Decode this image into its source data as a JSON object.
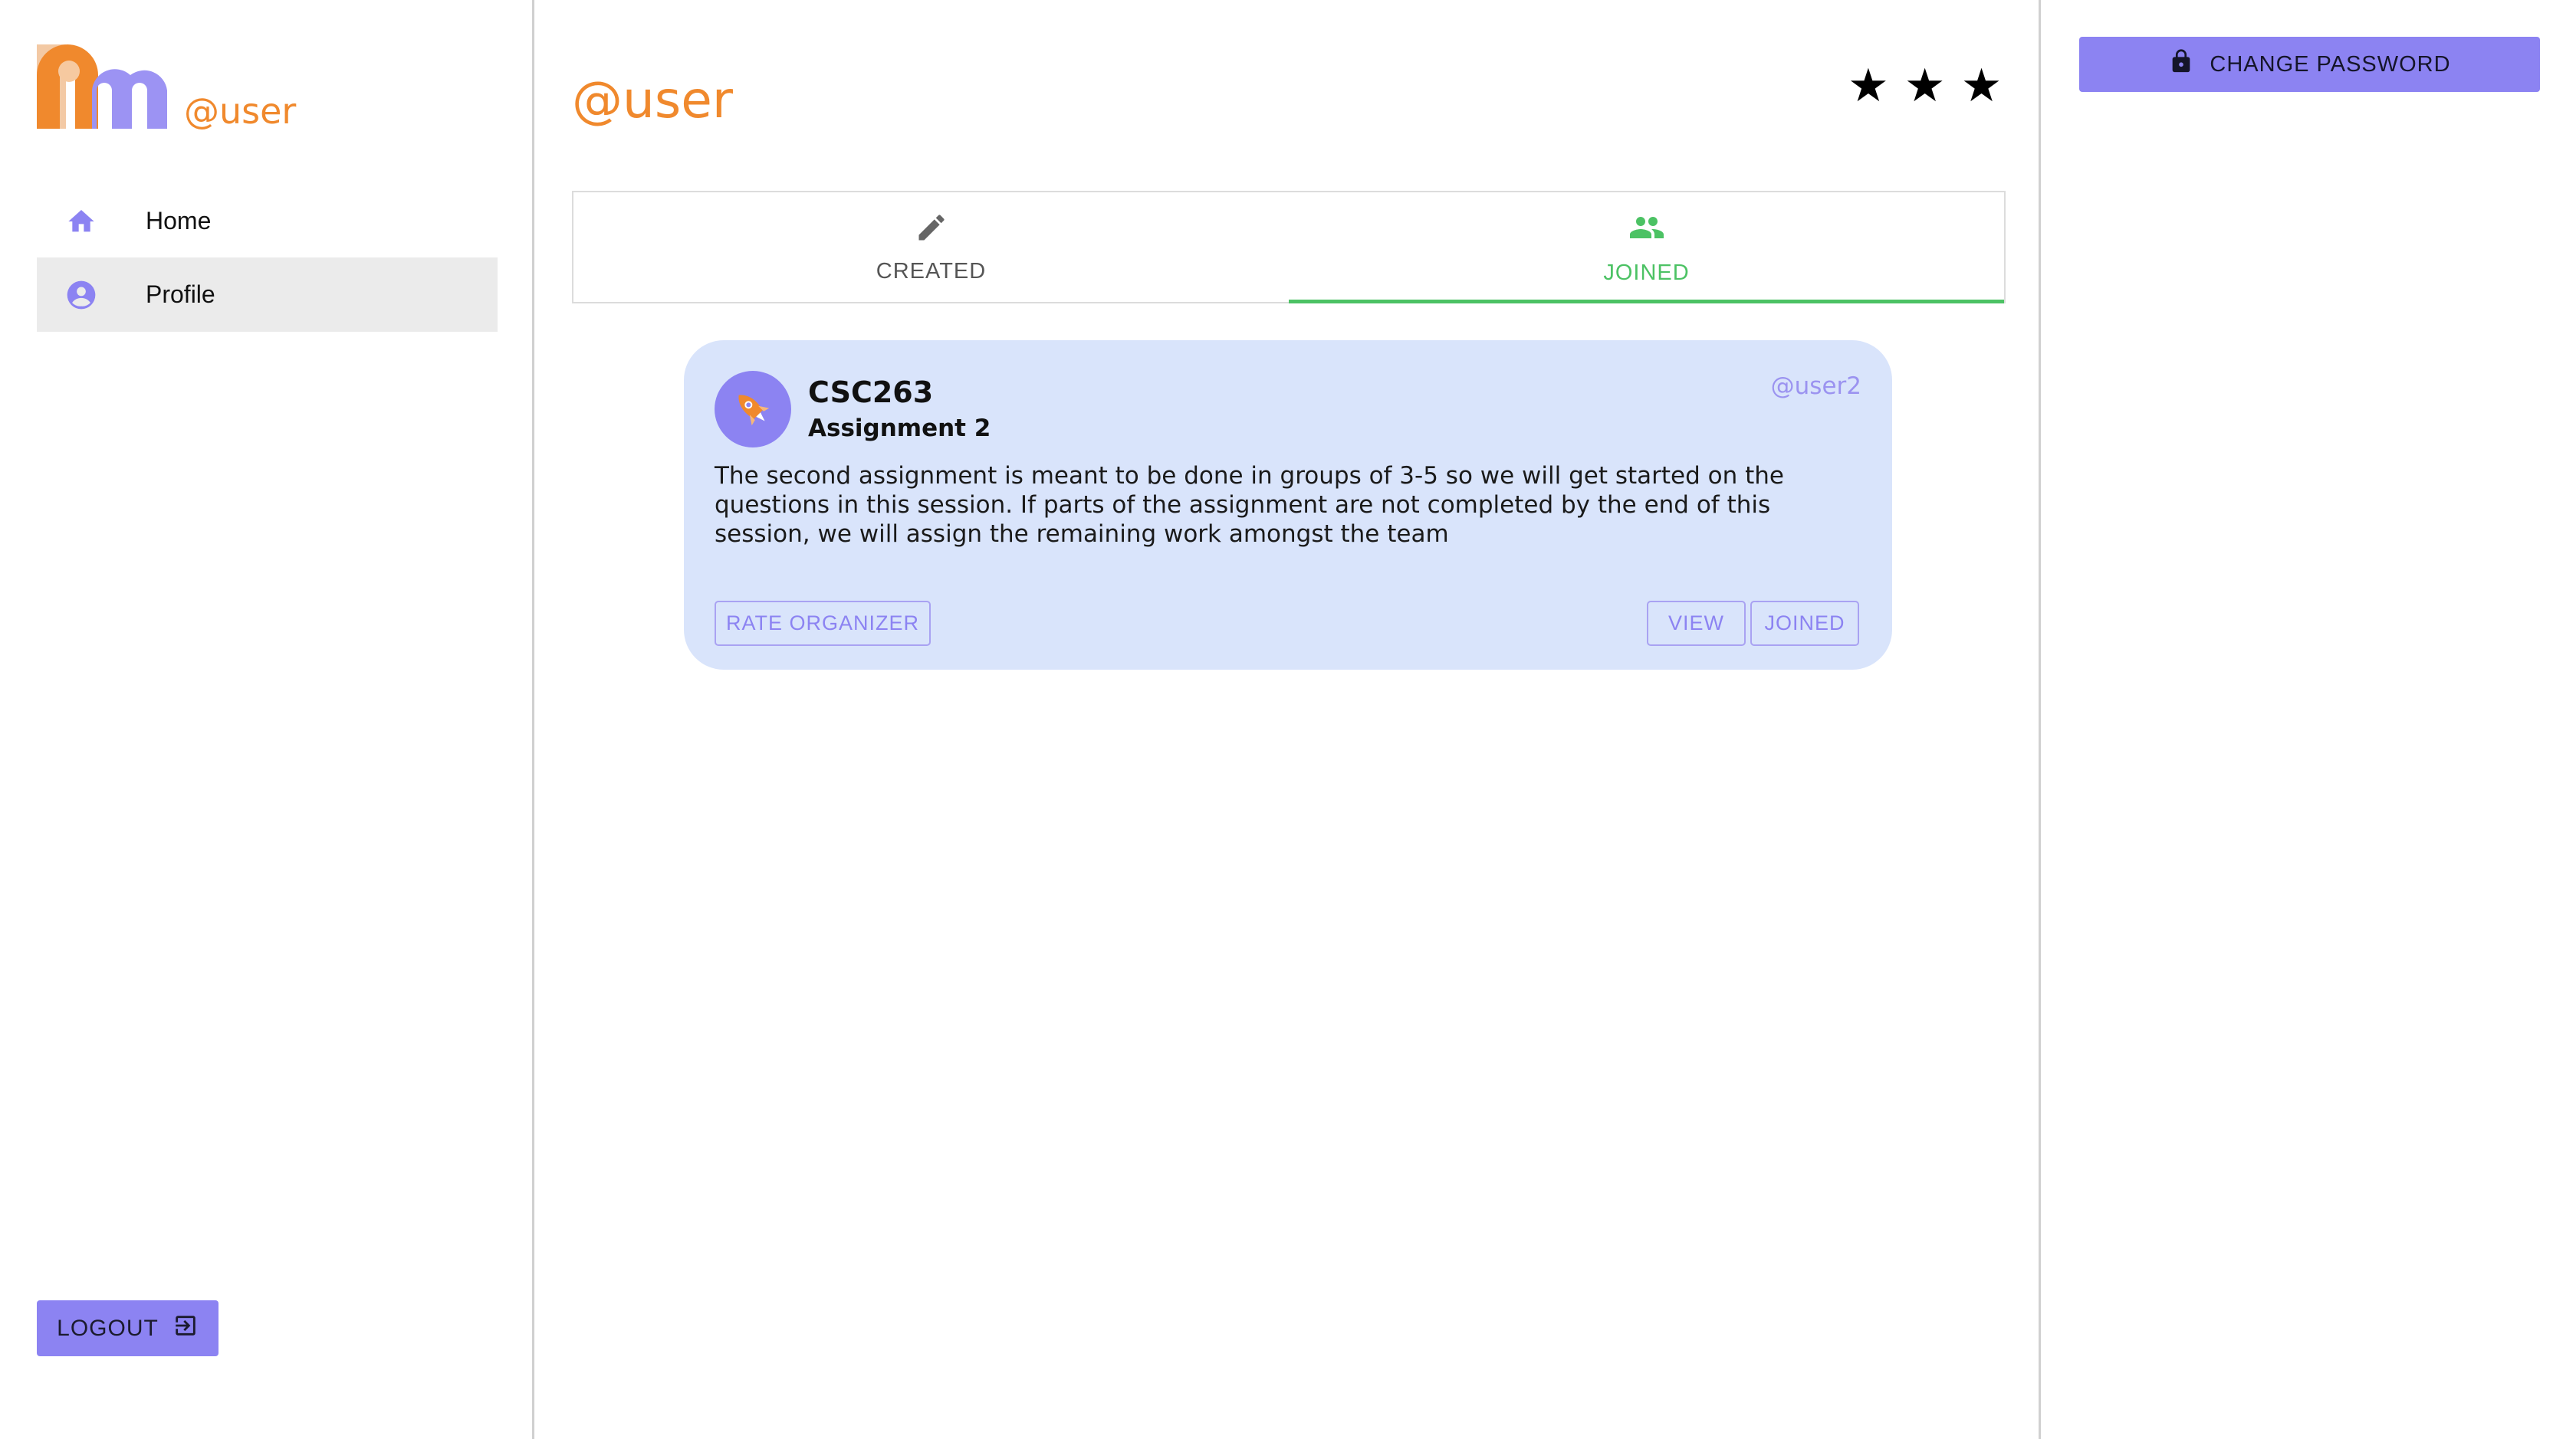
{
  "sidebar": {
    "username": "@user",
    "nav": [
      {
        "label": "Home",
        "icon": "home-icon"
      },
      {
        "label": "Profile",
        "icon": "account-circle-icon",
        "active": true
      }
    ],
    "logout_label": "LOGOUT"
  },
  "main": {
    "title": "@user",
    "rating_stars": 3,
    "tabs": [
      {
        "label": "CREATED",
        "icon": "pencil-icon",
        "selected": false
      },
      {
        "label": "JOINED",
        "icon": "group-icon",
        "selected": true
      }
    ],
    "card": {
      "title": "CSC263",
      "subtitle": "Assignment 2",
      "organizer": "@user2",
      "description": "The second assignment is meant to be done in groups of 3-5 so we will get started on the questions in this session. If parts of the assignment are not completed by the end of this session, we will assign the remaining work amongst the team",
      "rate_label": "RATE ORGANIZER",
      "view_label": "VIEW",
      "joined_label": "JOINED"
    }
  },
  "right_panel": {
    "change_password_label": "CHANGE PASSWORD"
  },
  "colors": {
    "accent_orange": "#f0892d",
    "accent_purple": "#8c83f2",
    "tab_active_green": "#4cc264",
    "card_bg": "#d9e4fb"
  }
}
